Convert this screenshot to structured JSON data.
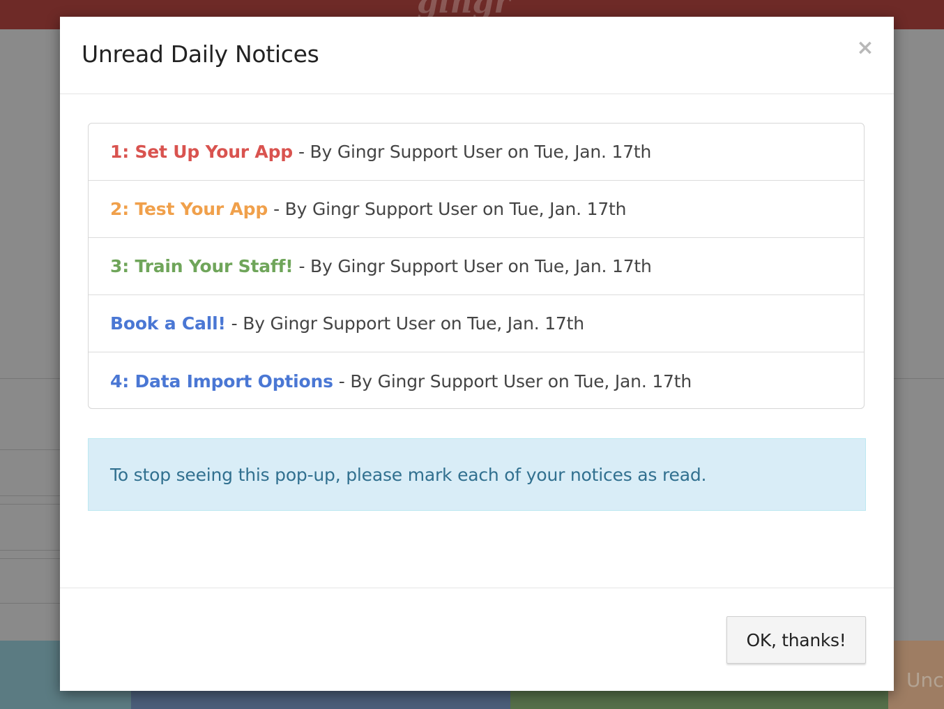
{
  "background": {
    "logo_text": "gingr",
    "tile_text": "Unc"
  },
  "modal": {
    "title": "Unread Daily Notices",
    "close_label": "×",
    "notices": [
      {
        "title": "1: Set Up Your App",
        "meta": "- By Gingr Support User on Tue, Jan. 17th",
        "color": "#d9534f"
      },
      {
        "title": "2: Test Your App",
        "meta": "- By Gingr Support User on Tue, Jan. 17th",
        "color": "#f0a04b"
      },
      {
        "title": "3: Train Your Staff!",
        "meta": "- By Gingr Support User on Tue, Jan. 17th",
        "color": "#6fa55a"
      },
      {
        "title": "Book a Call!",
        "meta": "- By Gingr Support User on Tue, Jan. 17th",
        "color": "#4a77d4"
      },
      {
        "title": "4: Data Import Options",
        "meta": "- By Gingr Support User on Tue, Jan. 17th",
        "color": "#4a77d4"
      }
    ],
    "info_message": "To stop seeing this pop-up, please mark each of your notices as read.",
    "ok_button": "OK, thanks!"
  },
  "colors": {
    "header_bg": "#6e2a27",
    "overlay_bg": "#8a8a8a",
    "info_bg": "#d9edf7",
    "info_text": "#31708f",
    "tile_teal": "#5b7b82",
    "tile_blue": "#4b5e7a",
    "tile_green": "#56704a",
    "tile_orange": "#9e7d63"
  }
}
